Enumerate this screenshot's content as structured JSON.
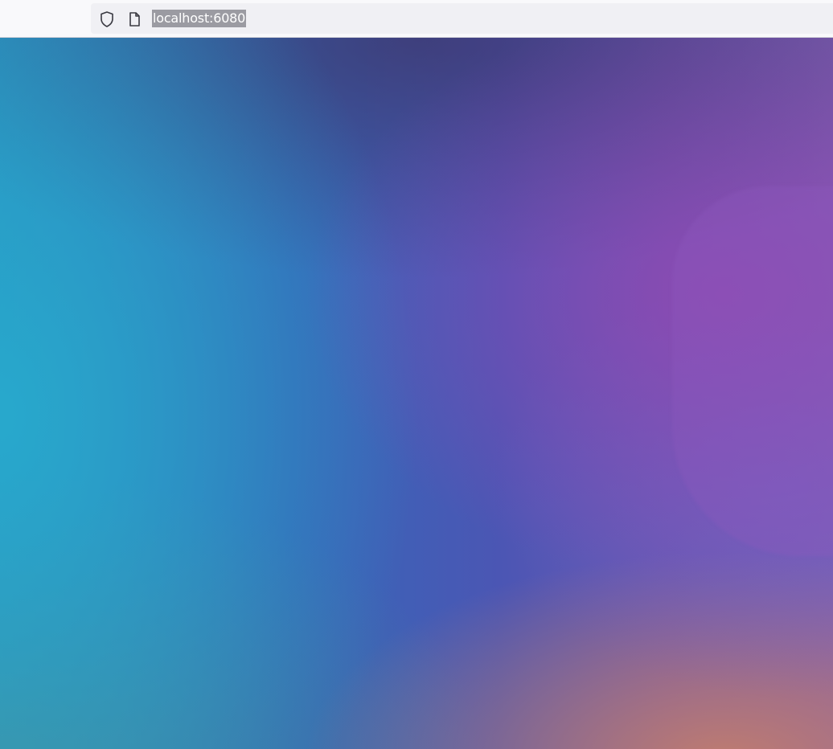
{
  "browser": {
    "url": "localhost:6080",
    "icons": [
      "shield-icon",
      "page-icon"
    ]
  },
  "desktop": {
    "background": {
      "colors": {
        "teal": "#2aa6c8",
        "blue": "#3668b8",
        "violet": "#4b56b4",
        "magenta": "#8a4fb0",
        "peach": "#c98470"
      }
    }
  }
}
